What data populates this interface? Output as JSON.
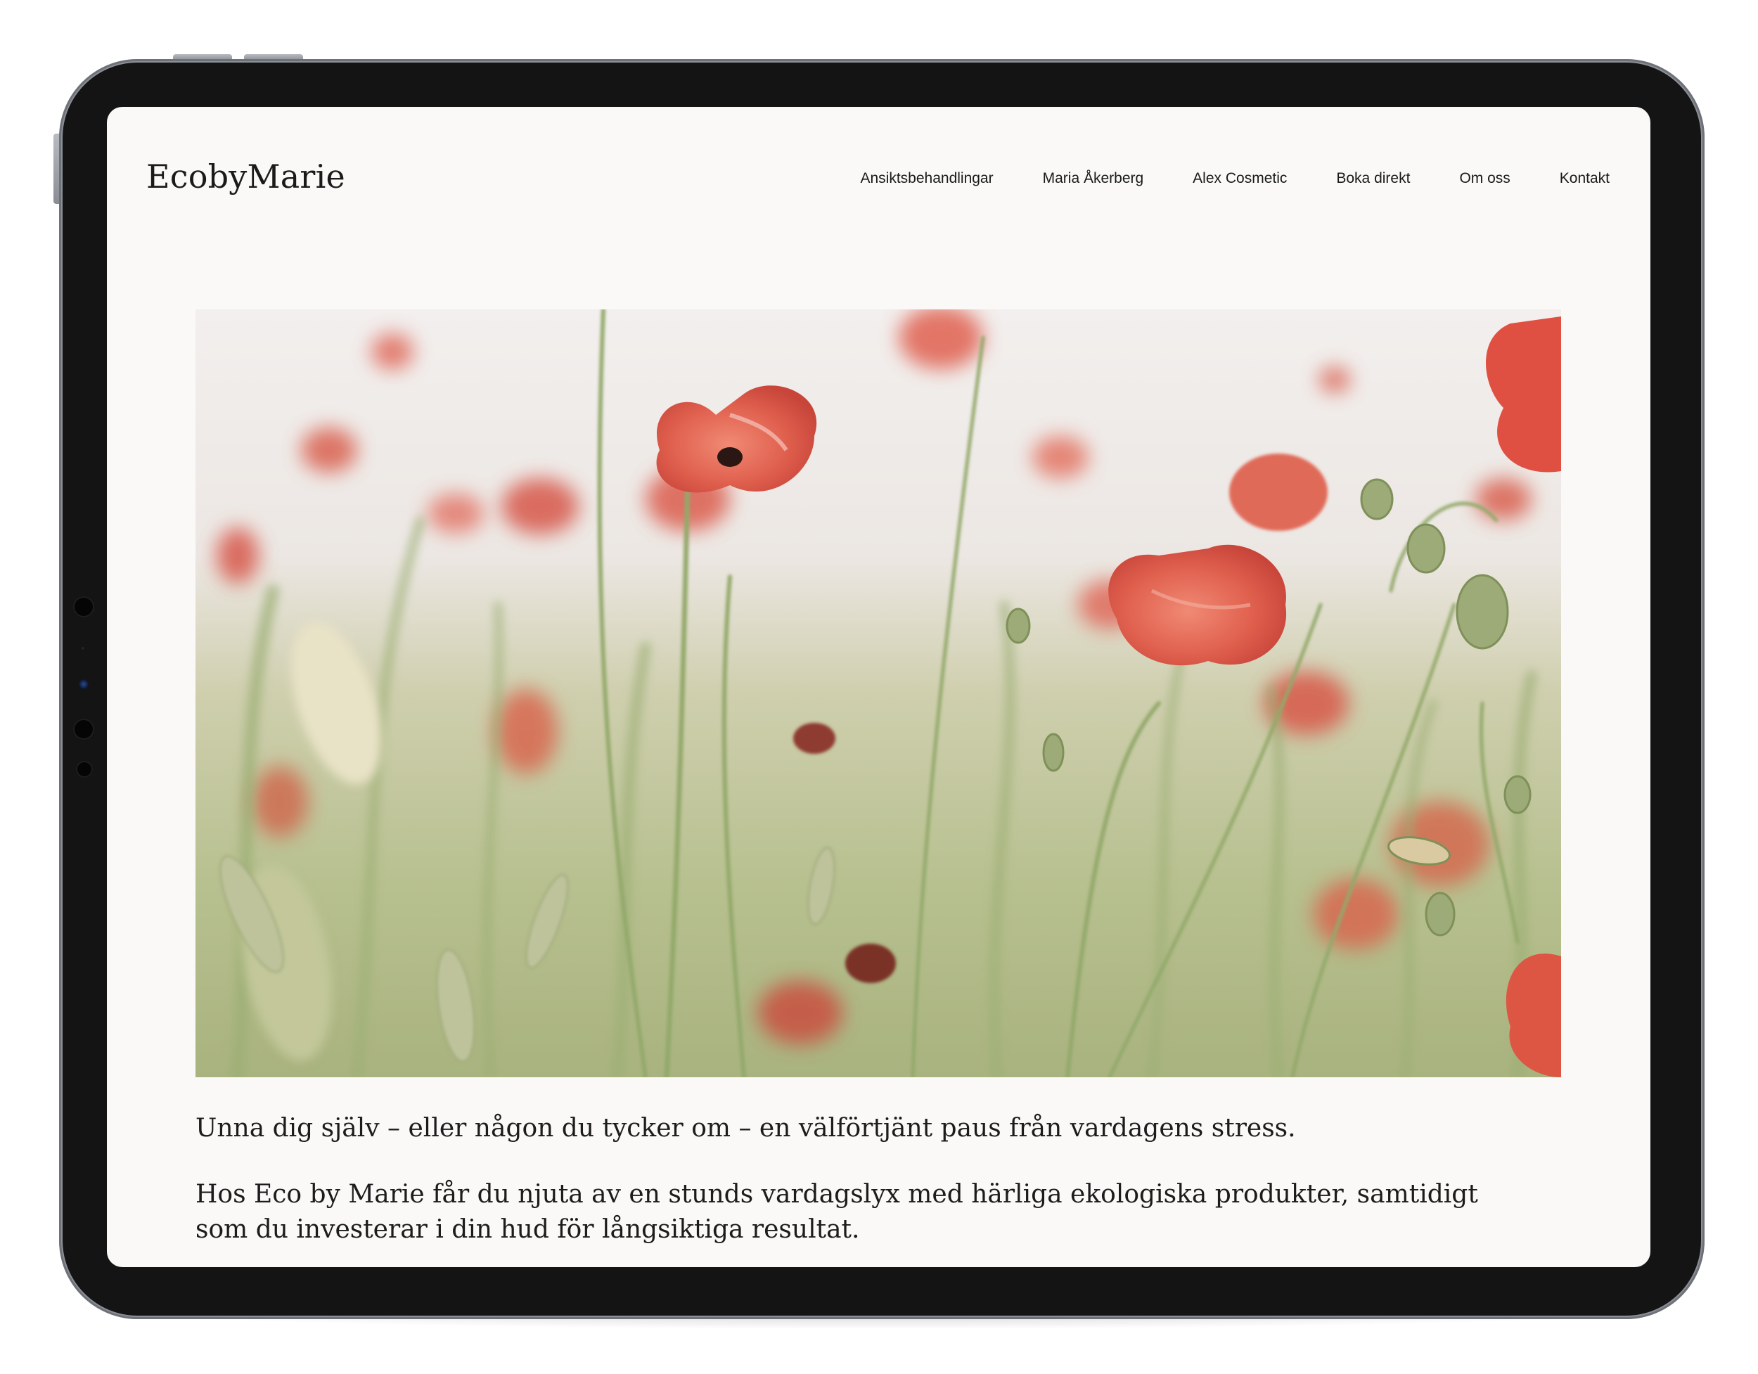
{
  "site": {
    "brand": "EcobyMarie"
  },
  "nav": {
    "items": [
      {
        "label": "Ansiktsbehandlingar"
      },
      {
        "label": "Maria Åkerberg"
      },
      {
        "label": "Alex Cosmetic"
      },
      {
        "label": "Boka direkt"
      },
      {
        "label": "Om oss"
      },
      {
        "label": "Kontakt"
      }
    ]
  },
  "hero": {
    "subject": "poppy-field-photo",
    "colors": {
      "sky": "#f1eeec",
      "field": "#b9c296",
      "poppy": "#e0584a",
      "stem": "#8ea46a"
    }
  },
  "content": {
    "paragraph_1": "Unna dig själv – eller någon du tycker om – en välförtjänt paus från vardagens stress.",
    "paragraph_2": "Hos Eco by Marie får du njuta av en stunds vardagslyx med härliga ekologiska produkter, samtidigt som du investerar i din hud för långsiktiga resultat."
  },
  "device": {
    "frame_color": "#141414",
    "screen_color": "#faf9f7"
  }
}
